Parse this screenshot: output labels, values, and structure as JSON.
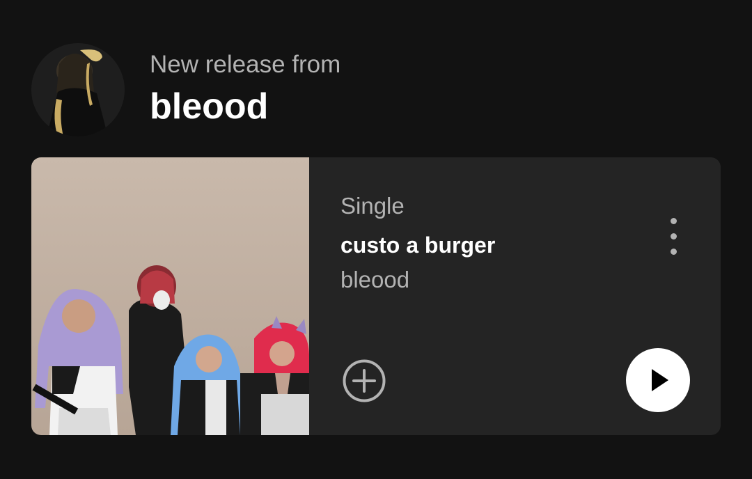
{
  "header": {
    "label": "New release from",
    "artist": "bleood"
  },
  "release": {
    "type": "Single",
    "title": "custo a burger",
    "artist": "bleood"
  },
  "icons": {
    "more": "more-vertical-icon",
    "add": "add-circle-icon",
    "play": "play-icon"
  },
  "colors": {
    "background": "#121212",
    "card": "#242424",
    "primary_text": "#ffffff",
    "secondary_text": "#b3b3b3"
  }
}
